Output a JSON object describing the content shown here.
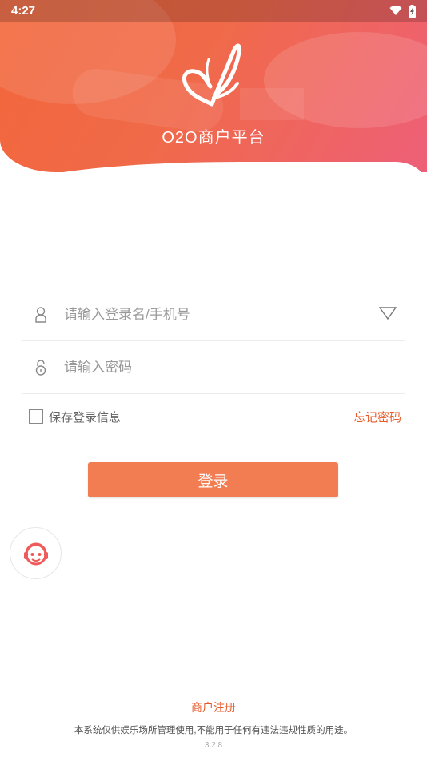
{
  "status_bar": {
    "time": "4:27"
  },
  "header": {
    "title": "O2O商户平台"
  },
  "form": {
    "username": {
      "placeholder": "请输入登录名/手机号",
      "value": ""
    },
    "password": {
      "placeholder": "请输入密码",
      "value": ""
    }
  },
  "options": {
    "save_label": "保存登录信息",
    "forgot_label": "忘记密码"
  },
  "login": {
    "label": "登录"
  },
  "footer": {
    "register_label": "商户注册",
    "disclaimer": "本系统仅供娱乐场所管理使用,不能用于任何有违法违规性质的用途。",
    "version": "3.2.8"
  },
  "colors": {
    "accent": "#f27d53",
    "link": "#e85a2a",
    "header_start": "#f2663a",
    "header_end": "#ee5f78"
  },
  "icons": [
    "wifi-icon",
    "battery-icon",
    "butterfly-logo-icon",
    "user-icon",
    "dropdown-triangle-icon",
    "lock-icon",
    "customer-service-icon"
  ]
}
